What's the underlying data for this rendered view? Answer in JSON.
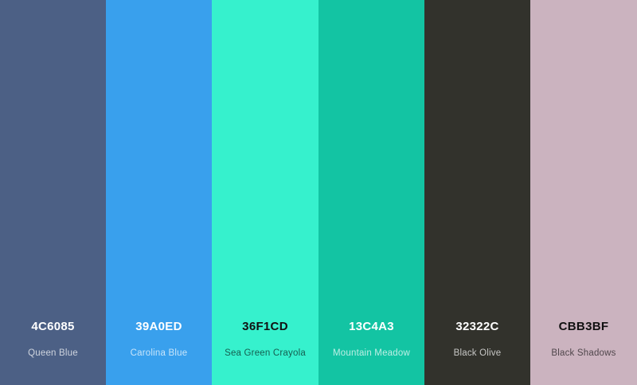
{
  "swatches": [
    {
      "hex": "4C6085",
      "name": "Queen Blue",
      "color": "#4C6085",
      "text_tone": "light"
    },
    {
      "hex": "39A0ED",
      "name": "Carolina Blue",
      "color": "#39A0ED",
      "text_tone": "light"
    },
    {
      "hex": "36F1CD",
      "name": "Sea Green Crayola",
      "color": "#36F1CD",
      "text_tone": "dark"
    },
    {
      "hex": "13C4A3",
      "name": "Mountain Meadow",
      "color": "#13C4A3",
      "text_tone": "light"
    },
    {
      "hex": "32322C",
      "name": "Black Olive",
      "color": "#32322C",
      "text_tone": "light"
    },
    {
      "hex": "CBB3BF",
      "name": "Black Shadows",
      "color": "#CBB3BF",
      "text_tone": "dark"
    }
  ]
}
